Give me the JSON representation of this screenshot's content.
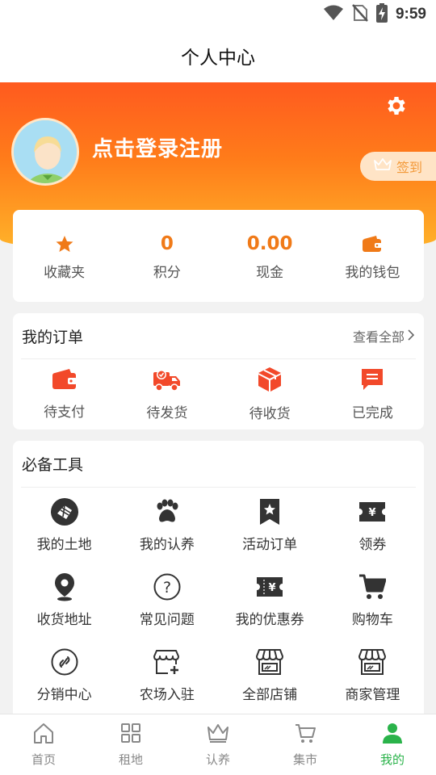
{
  "status_bar": {
    "time": "9:59",
    "icons": [
      "wifi-icon",
      "no-sim-icon",
      "battery-charging-icon"
    ]
  },
  "title": "个人中心",
  "header": {
    "login_text": "点击登录注册",
    "signin_label": "签到",
    "settings_icon": "gear-icon",
    "avatar_icon": "avatar-icon"
  },
  "stats": [
    {
      "name": "favorites",
      "value": "",
      "icon": "star-icon",
      "label": "收藏夹"
    },
    {
      "name": "points",
      "value": "0",
      "label": "积分"
    },
    {
      "name": "cash",
      "value": "0.00",
      "label": "现金"
    },
    {
      "name": "wallet",
      "value": "",
      "icon": "wallet-icon",
      "label": "我的钱包"
    }
  ],
  "orders": {
    "title": "我的订单",
    "view_all": "查看全部",
    "items": [
      {
        "label": "待支付",
        "icon": "wallet-icon"
      },
      {
        "label": "待发货",
        "icon": "truck-icon"
      },
      {
        "label": "待收货",
        "icon": "package-icon"
      },
      {
        "label": "已完成",
        "icon": "message-icon"
      }
    ]
  },
  "tools": {
    "title": "必备工具",
    "items": [
      {
        "label": "我的土地",
        "icon": "land-icon"
      },
      {
        "label": "我的认养",
        "icon": "paw-icon"
      },
      {
        "label": "活动订单",
        "icon": "bookmark-star-icon"
      },
      {
        "label": "领券",
        "icon": "coupon-icon"
      },
      {
        "label": "收货地址",
        "icon": "location-pin-icon"
      },
      {
        "label": "常见问题",
        "icon": "question-icon"
      },
      {
        "label": "我的优惠券",
        "icon": "ticket-icon"
      },
      {
        "label": "购物车",
        "icon": "cart-icon"
      },
      {
        "label": "分销中心",
        "icon": "share-link-icon"
      },
      {
        "label": "农场入驻",
        "icon": "farm-join-icon"
      },
      {
        "label": "全部店铺",
        "icon": "store-icon"
      },
      {
        "label": "商家管理",
        "icon": "store-manage-icon"
      }
    ]
  },
  "bottom_nav": [
    {
      "label": "首页",
      "icon": "home-icon",
      "active": false
    },
    {
      "label": "租地",
      "icon": "grid-icon",
      "active": false
    },
    {
      "label": "认养",
      "icon": "crown-icon",
      "active": false
    },
    {
      "label": "集市",
      "icon": "basket-icon",
      "active": false
    },
    {
      "label": "我的",
      "icon": "user-icon",
      "active": true
    }
  ],
  "colors": {
    "accent": "#f07a18",
    "header_top": "#ff5a1f",
    "header_bottom": "#ffb52a",
    "order_icon": "#f2492a",
    "nav_active": "#2ab34a"
  }
}
